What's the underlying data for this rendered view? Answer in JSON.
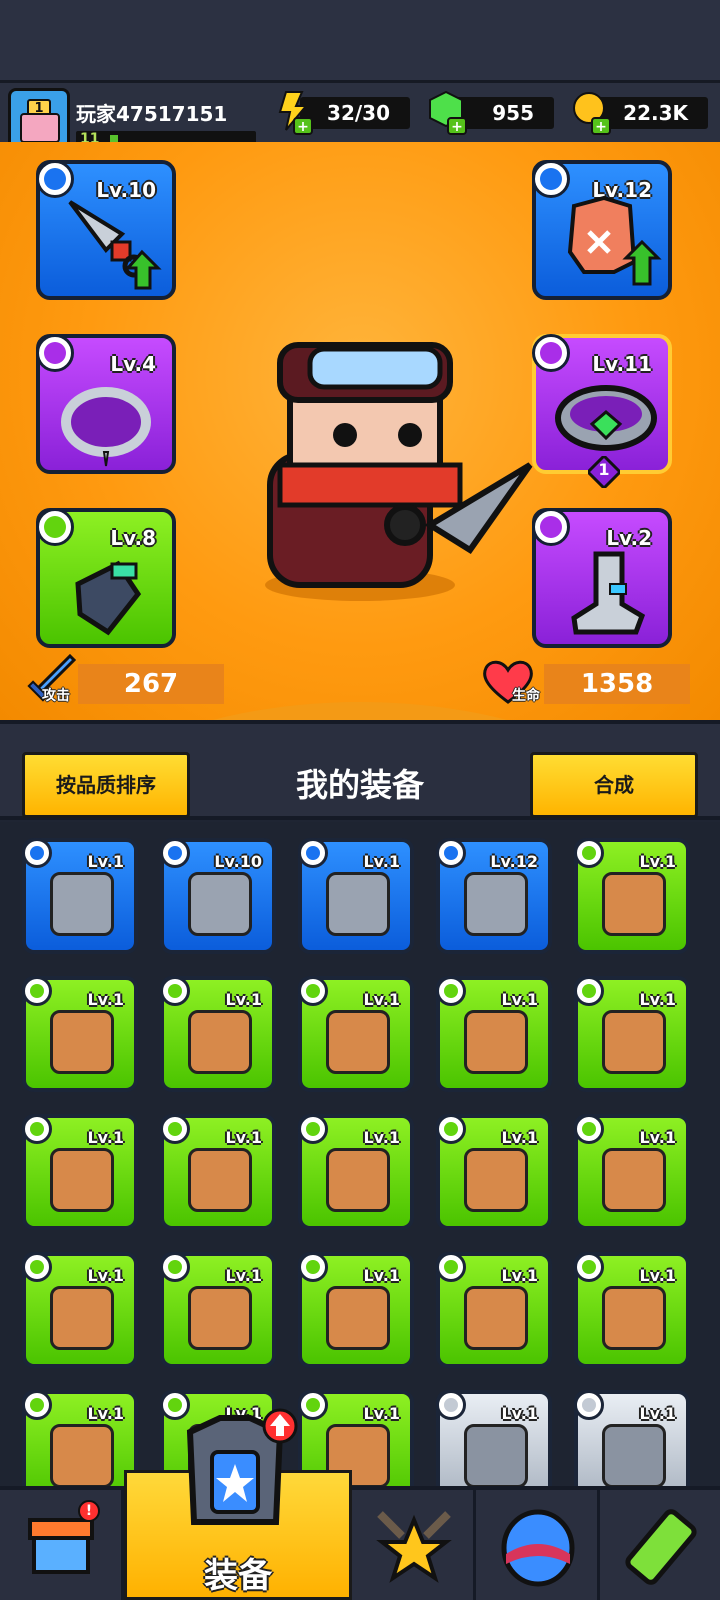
{
  "player": {
    "name": "玩家47517151",
    "level": "11",
    "xp_fraction": 0.05
  },
  "resources": {
    "energy": "32/30",
    "gems": "955",
    "coins": "22.3K"
  },
  "equipped": [
    {
      "slot": "weapon",
      "level": "Lv.10",
      "color": "blue"
    },
    {
      "slot": "armor",
      "level": "Lv.12",
      "color": "blue"
    },
    {
      "slot": "necklace",
      "level": "Lv.4",
      "color": "purple"
    },
    {
      "slot": "ring",
      "level": "Lv.11",
      "color": "purple",
      "count": "1"
    },
    {
      "slot": "glove",
      "level": "Lv.8",
      "color": "green"
    },
    {
      "slot": "boot",
      "level": "Lv.2",
      "color": "purple"
    }
  ],
  "stats": {
    "attack_label": "攻击",
    "attack": "267",
    "hp_label": "生命",
    "hp": "1358"
  },
  "toolbar": {
    "sort_label": "按品质排序",
    "title": "我的装备",
    "merge_label": "合成"
  },
  "inventory": [
    {
      "level": "Lv.1",
      "color": "blue",
      "icon": "armor-icon"
    },
    {
      "level": "Lv.10",
      "color": "blue",
      "icon": "necklace-icon"
    },
    {
      "level": "Lv.1",
      "color": "blue",
      "icon": "belt-icon"
    },
    {
      "level": "Lv.12",
      "color": "blue",
      "icon": "boot-icon"
    },
    {
      "level": "Lv.1",
      "color": "green",
      "icon": "revolver-icon"
    },
    {
      "level": "Lv.1",
      "color": "green",
      "icon": "shotgun-icon"
    },
    {
      "level": "Lv.1",
      "color": "green",
      "icon": "shotgun-icon"
    },
    {
      "level": "Lv.1",
      "color": "green",
      "icon": "bat-icon"
    },
    {
      "level": "Lv.1",
      "color": "green",
      "icon": "bat-icon"
    },
    {
      "level": "Lv.1",
      "color": "green",
      "icon": "bone-necklace-icon"
    },
    {
      "level": "Lv.1",
      "color": "green",
      "icon": "bone-necklace-icon"
    },
    {
      "level": "Lv.1",
      "color": "green",
      "icon": "star-necklace-icon"
    },
    {
      "level": "Lv.1",
      "color": "green",
      "icon": "gem-necklace-icon"
    },
    {
      "level": "Lv.1",
      "color": "green",
      "icon": "belt-icon"
    },
    {
      "level": "Lv.1",
      "color": "green",
      "icon": "dogtag-necklace-icon"
    },
    {
      "level": "Lv.1",
      "color": "green",
      "icon": "fur-belt-icon"
    },
    {
      "level": "Lv.1",
      "color": "green",
      "icon": "belt-icon"
    },
    {
      "level": "Lv.1",
      "color": "green",
      "icon": "glove-icon"
    },
    {
      "level": "Lv.1",
      "color": "green",
      "icon": "glove-icon"
    },
    {
      "level": "Lv.1",
      "color": "green",
      "icon": "fur-boot-icon"
    },
    {
      "level": "Lv.1",
      "color": "green",
      "icon": "boot-icon"
    },
    {
      "level": "Lv.1",
      "color": "green",
      "icon": "boot-icon"
    },
    {
      "level": "Lv.1",
      "color": "green",
      "icon": "boot-icon"
    },
    {
      "level": "Lv.1",
      "color": "grey",
      "icon": "kunai-icon"
    },
    {
      "level": "Lv.1",
      "color": "grey",
      "icon": "kunai-icon"
    }
  ],
  "nav": {
    "active_label": "装备"
  },
  "colors": {
    "blue": "#1a73f0",
    "purple": "#a92ee8",
    "green": "#62d40e",
    "grey": "#c3cad4",
    "orange": "#ff9a10"
  }
}
